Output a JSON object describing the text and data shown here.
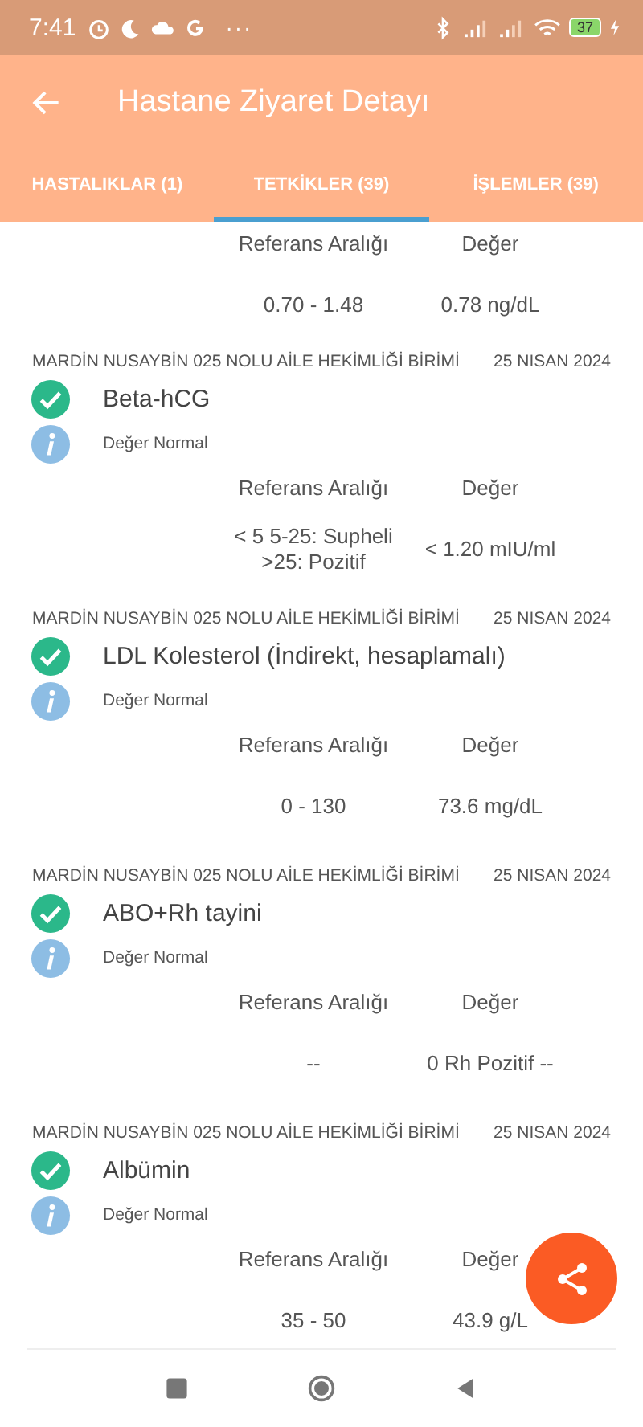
{
  "status_bar": {
    "time": "7:41",
    "more": "···",
    "battery": "37"
  },
  "app_bar": {
    "title": "Hastane Ziyaret Detayı"
  },
  "tabs": [
    {
      "label": "HASTALIKLAR (1)",
      "selected": false
    },
    {
      "label": "TETKİKLER (39)",
      "selected": true
    },
    {
      "label": "İŞLEMLER (39)",
      "selected": false
    }
  ],
  "partial_result": {
    "reference_header": "Referans Aralığı",
    "value_header": "Değer",
    "reference": "0.70 - 1.48",
    "value": "0.78 ng/dL"
  },
  "results": [
    {
      "facility": "MARDİN NUSAYBİN 025 NOLU AİLE HEKİMLİĞİ BİRİMİ",
      "date": "25 NISAN 2024",
      "name": "Beta-hCG",
      "ok": true,
      "note": "Değer Normal",
      "reference_header": "Referans Aralığı",
      "value_header": "Değer",
      "reference": "< 5 5-25: Supheli >25: Pozitif",
      "value": "< 1.20 mIU/ml"
    },
    {
      "facility": "MARDİN NUSAYBİN 025 NOLU AİLE HEKİMLİĞİ BİRİMİ",
      "date": "25 NISAN 2024",
      "name": "LDL Kolesterol (İndirekt, hesaplamalı)",
      "ok": true,
      "note": "Değer Normal",
      "reference_header": "Referans Aralığı",
      "value_header": "Değer",
      "reference": "0 - 130",
      "value": "73.6 mg/dL"
    },
    {
      "facility": "MARDİN NUSAYBİN 025 NOLU AİLE HEKİMLİĞİ BİRİMİ",
      "date": "25 NISAN 2024",
      "name": "ABO+Rh tayini",
      "ok": true,
      "note": "Değer Normal",
      "reference_header": "Referans Aralığı",
      "value_header": "Değer",
      "reference": "--",
      "value": "0 Rh Pozitif --"
    },
    {
      "facility": "MARDİN NUSAYBİN 025 NOLU AİLE HEKİMLİĞİ BİRİMİ",
      "date": "25 NISAN 2024",
      "name": "Albümin",
      "ok": true,
      "note": "Değer Normal",
      "reference_header": "Referans Aralığı",
      "value_header": "Değer",
      "reference": "35 - 50",
      "value": "43.9 g/L"
    }
  ]
}
